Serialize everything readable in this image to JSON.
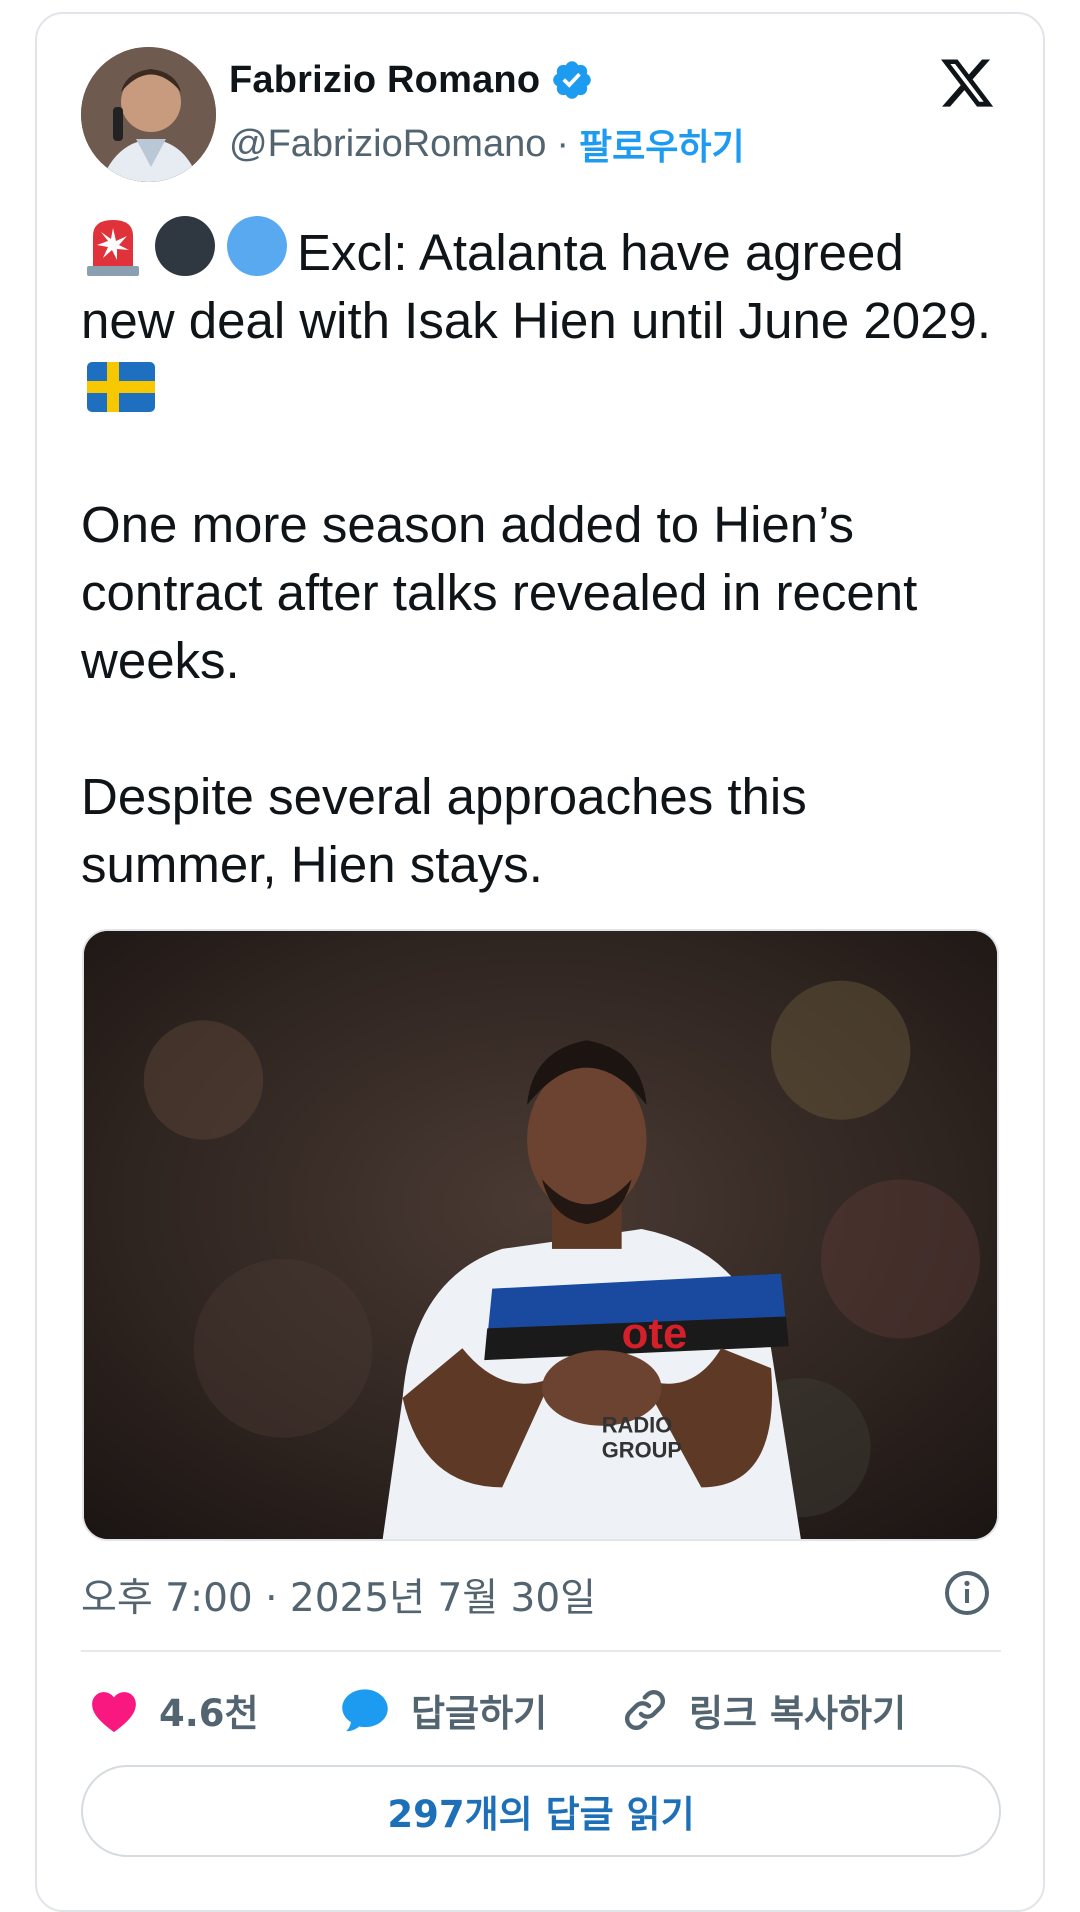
{
  "author": {
    "name": "Fabrizio Romano",
    "handle": "@FabrizioRomano",
    "separator": "·",
    "follow_label": "팔로우하기",
    "verified_icon": "verified-badge-icon",
    "avatar_icon": "profile-photo"
  },
  "brand": {
    "logo": "x-logo-icon"
  },
  "tweet": {
    "emojis": [
      "rotating-light-emoji",
      "black-circle-emoji",
      "blue-circle-emoji"
    ],
    "paragraph1": "Excl: Atalanta have agreed new deal with Isak Hien until June 2029.",
    "paragraph1_flag": "sweden-flag-emoji",
    "paragraph2": "One more season added to Hien’s contract after talks revealed in recent weeks.",
    "paragraph3": "Despite several approaches this summer, Hien stays.",
    "media_icon": "football-player-photo"
  },
  "meta": {
    "timestamp": "오후 7:00 · 2025년 7월 30일",
    "info_icon": "info-icon"
  },
  "actions": {
    "like_count": "4.6천",
    "reply_label": "답글하기",
    "copy_link_label": "링크 복사하기"
  },
  "replies": {
    "read_label": "297개의 답글 읽기"
  },
  "colors": {
    "accent": "#1d9bf0",
    "like": "#f91880",
    "text": "#0f1419",
    "muted": "#536471",
    "border": "#e1e4e8"
  }
}
